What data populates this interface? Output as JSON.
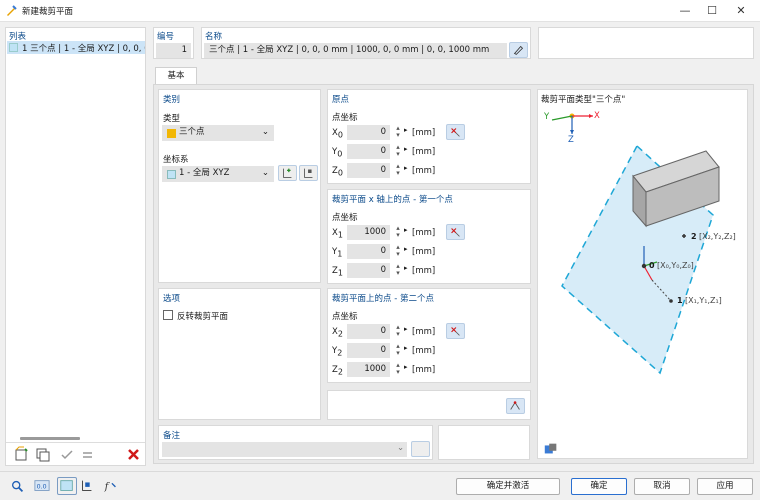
{
  "window": {
    "title": "新建裁剪平面",
    "min": "—",
    "max": "☐",
    "close": "✕"
  },
  "list": {
    "header": "列表",
    "item": "1 三个点 | 1 - 全局 XYZ | 0, 0, 0 m"
  },
  "number": {
    "label": "编号",
    "value": "1"
  },
  "name": {
    "label": "名称",
    "value": "三个点 | 1 - 全局 XYZ | 0, 0, 0 mm | 1000, 0, 0 mm | 0, 0, 1000 mm"
  },
  "tab": {
    "basic": "基本"
  },
  "category": {
    "header": "类别",
    "type_label": "类型",
    "type_value": "三个点",
    "cs_label": "坐标系",
    "cs_value": "1 - 全局 XYZ",
    "type_color": "#f2b705"
  },
  "origin": {
    "header": "原点",
    "coord_label": "点坐标",
    "x_label": "X",
    "x_sub": "0",
    "x_value": "0",
    "y_label": "Y",
    "y_sub": "0",
    "y_value": "0",
    "z_label": "Z",
    "z_sub": "0",
    "z_value": "0",
    "unit": "[mm]"
  },
  "p1": {
    "header": "裁剪平面 x 轴上的点 - 第一个点",
    "coord_label": "点坐标",
    "x_label": "X",
    "x_sub": "1",
    "x_value": "1000",
    "y_label": "Y",
    "y_sub": "1",
    "y_value": "0",
    "z_label": "Z",
    "z_sub": "1",
    "z_value": "0",
    "unit": "[mm]"
  },
  "p2": {
    "header": "裁剪平面上的点 - 第二个点",
    "coord_label": "点坐标",
    "x_label": "X",
    "x_sub": "2",
    "x_value": "0",
    "y_label": "Y",
    "y_sub": "2",
    "y_value": "0",
    "z_label": "Z",
    "z_sub": "2",
    "z_value": "1000",
    "unit": "[mm]"
  },
  "options": {
    "header": "选项",
    "reverse_label": "反转裁剪平面",
    "reverse_checked": false
  },
  "comment": {
    "header": "备注",
    "value": ""
  },
  "preview": {
    "title": "裁剪平面类型\"三个点\"",
    "ax_x": "X",
    "ax_y": "Y",
    "ax_z": "Z",
    "p0_num": "0",
    "p0_lbl": "[X₀,Y₀,Z₀]",
    "p1_num": "1",
    "p1_lbl": "[X₁,Y₁,Z₁]",
    "p2_num": "2",
    "p2_lbl": "[X₂,Y₂,Z₂]"
  },
  "footer": {
    "ok_activate": "确定并激活",
    "ok": "确定",
    "cancel": "取消",
    "apply": "应用"
  }
}
